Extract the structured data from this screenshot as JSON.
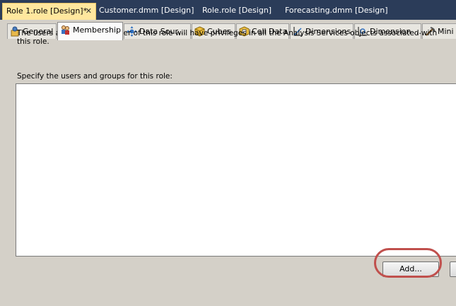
{
  "doc_tabs": [
    {
      "label": "Role 1.role [Design]*",
      "active": true
    },
    {
      "label": "Customer.dmm [Design]",
      "active": false
    },
    {
      "label": "Role.role [Design]",
      "active": false
    },
    {
      "label": "Forecasting.dmm [Design]",
      "active": false
    }
  ],
  "close_glyph": "✕",
  "sub_tabs": [
    {
      "label": "General",
      "icon": "general-icon"
    },
    {
      "label": "Membership",
      "icon": "membership-icon",
      "active": true
    },
    {
      "label": "Data Sour…",
      "icon": "data-sources-icon"
    },
    {
      "label": "Cubes",
      "icon": "cubes-icon"
    },
    {
      "label": "Cell Data",
      "icon": "cell-data-icon"
    },
    {
      "label": "Dimensions",
      "icon": "dimensions-icon"
    },
    {
      "label": "Dimension …",
      "icon": "dimension-data-icon"
    },
    {
      "label": "Mini",
      "icon": "mining-icon"
    }
  ],
  "membership": {
    "description": "The users and groups member of this role will have privileges in all the Analysis Services objects associated with this role.",
    "list_label": "Specify the users and groups for this role:",
    "add_button": "Add..."
  },
  "colors": {
    "tab_strip": "#2b3c59",
    "active_doc_tab": "#ffe79e",
    "highlight": "#c0504d"
  }
}
